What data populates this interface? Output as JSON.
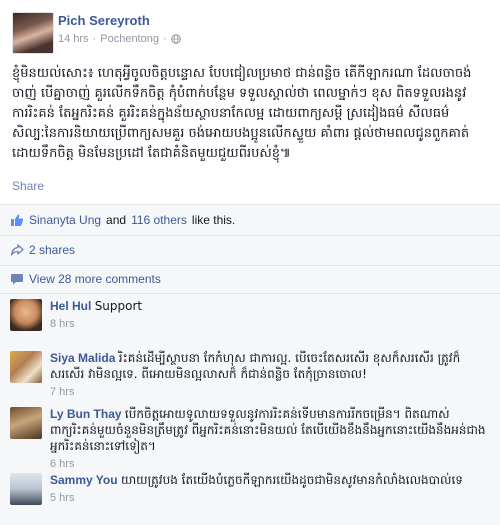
{
  "post": {
    "author": "Pich Sereyroth",
    "time": "14 hrs",
    "separator": "·",
    "location": "Pochentong",
    "text": "ខ្ញុំមិនយល់សោះ៖ ហេតុអ្វីចូលចិត្តបន្ទោស បែបជៀលប្រមាថ ជាន់ពន្លិច តើកីឡាករណា ដែលចាចង់ចាញ់ បើគ្នាចាញ់ គួរលើកទឹកចិត្ត កុំបំពាក់បន្ថែម ទទួលស្គាល់ថា ពេលម្នាក់ៗ ខុស ពិតទទួលរងនូវការរិះគន់ តែអ្នករិះគន់ គួររិះគន់ក្នុងន័យស្ថាបនាកែលម្អ ដោយពាក្យសម្ដី ស្រដៀងធម៌ សីលធម៌ សិល្បៈនៃការនិយាយប្រើពាក្យសមគួរ ចង់អោយបងប្អូនលើកស្ទួយ គាំពារ ផ្ដល់ថាមពលជូនពួកគាត់ដោយទឹកចិត្ត មិនមែនប្រដៅ តែជាគំនិតមួយជួយពីរបស់ខ្ញុំ៕",
    "share_label": "Share"
  },
  "feedback": {
    "likes_names": "Sinanyta Ung",
    "likes_and": "and",
    "likes_others": "116 others",
    "likes_suffix": "like this.",
    "shares": "2 shares",
    "more_comments": "View 28 more comments"
  },
  "comments": [
    {
      "name": "Hel Hul",
      "text": "Support",
      "time": "8 hrs"
    },
    {
      "name": "Siya Malida",
      "text": "រិះគន់ដើម្បីស្ថាបនា កែកំហុស ជាការល្អ. បើចេះតែសរសើរ ខុសក៏សរសើរ ត្រូវក៏សរសើរ វាមិនល្អទេ. ពីអោយមិនល្អលាសក៏ ក៏ជាន់ពន្លិច តែកុំច្រានចោល!",
      "time": "7 hrs"
    },
    {
      "name": "Ly Bun Thay",
      "text": "បើកចិត្តអោយទូលាយទទួលនូវការរិះគន់ទើបមានការរីកចម្រើន។ ពិតណាស់ពាក្យរិះគន់មួយចំនួនមិនត្រឹមត្រូវ ពីអ្នករិះគន់នោះមិនយល់ តែបើយើងខឹងនឹងអ្នកនោះយើងនឹងអន់ជាងអ្នករិះគន់នោះទៅទៀត។",
      "time": "6 hrs"
    },
    {
      "name": "Sammy You",
      "text": "យាយត្រូវបង តែយើងបំភ្លេចកីឡាករយើងដូចជាមិនសូវមានកំលាំងលេងបាល់ទេ",
      "time": "5 hrs"
    }
  ],
  "colors": {
    "link": "#3b5998",
    "meta": "#9197a3",
    "ufi_bg": "#f6f7f8"
  },
  "icons": {
    "privacy": "globe-icon",
    "like": "thumbs-up-icon",
    "share": "share-arrow-icon",
    "comments": "comment-bubble-icon"
  }
}
